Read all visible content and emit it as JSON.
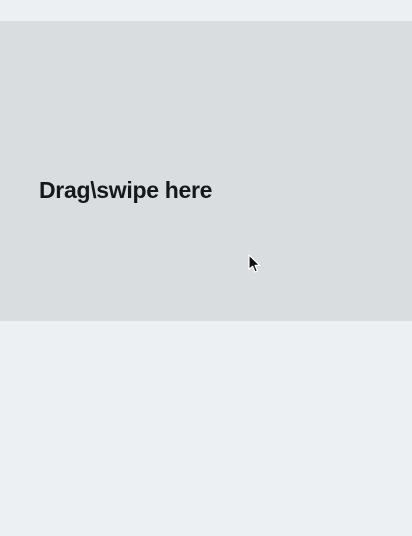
{
  "swipe_area": {
    "label": "Drag\\swipe here"
  },
  "cursor": {
    "icon": "mouse-pointer-icon"
  },
  "colors": {
    "page_background": "#edf0f3",
    "swipe_area_background": "#dadde0",
    "label_text": "#16181a"
  }
}
